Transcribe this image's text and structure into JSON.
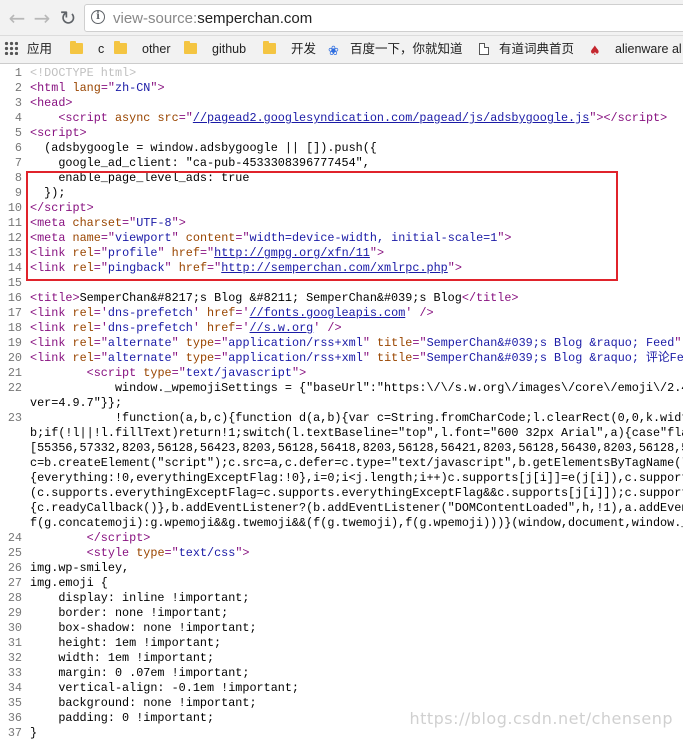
{
  "browser": {
    "back_icon": "arrow-left-icon",
    "forward_icon": "arrow-right-icon",
    "reload_icon": "reload-icon",
    "address": {
      "scheme": "view-source:",
      "host": "semperchan.com"
    }
  },
  "bookmarks": [
    {
      "label": "应用",
      "icon": "apps-grid-icon"
    },
    {
      "label": "c",
      "icon": "folder-icon"
    },
    {
      "label": "other",
      "icon": "folder-icon"
    },
    {
      "label": "github",
      "icon": "folder-icon"
    },
    {
      "label": "开发",
      "icon": "folder-icon"
    },
    {
      "label": "百度一下，你就知道",
      "icon": "paw-icon"
    },
    {
      "label": "有道词典首页",
      "icon": "page-icon"
    },
    {
      "label": "alienware al",
      "icon": "brand-icon"
    }
  ],
  "source_lines": [
    {
      "n": "1",
      "html": "<span class='doctype'>&lt;!DOCTYPE html&gt;</span>"
    },
    {
      "n": "2",
      "html": "<span class='tag'>&lt;html </span><span class='attr'>lang</span><span class='tag'>=\"</span><span class='val'>zh-CN</span><span class='tag'>\"&gt;</span>"
    },
    {
      "n": "3",
      "html": "<span class='tag'>&lt;head&gt;</span>"
    },
    {
      "n": "4",
      "html": "    <span class='tag'>&lt;script </span><span class='attr'>async src</span><span class='tag'>=\"</span><span class='link'>//pagead2.googlesyndication.com/pagead/js/adsbygoogle.js</span><span class='tag'>\"&gt;&lt;/script&gt;</span>"
    },
    {
      "n": "5",
      "html": "<span class='tag'>&lt;script&gt;</span>"
    },
    {
      "n": "6",
      "html": "  (adsbygoogle = window.adsbygoogle || []).push({"
    },
    {
      "n": "7",
      "html": "    google_ad_client: \"ca-pub-4533308396777454\","
    },
    {
      "n": "8",
      "html": "    enable_page_level_ads: true"
    },
    {
      "n": "9",
      "html": "  });"
    },
    {
      "n": "10",
      "html": "<span class='tag'>&lt;/script&gt;</span>"
    },
    {
      "n": "11",
      "html": "<span class='tag'>&lt;meta </span><span class='attr'>charset</span><span class='tag'>=\"</span><span class='val'>UTF-8</span><span class='tag'>\"&gt;</span>"
    },
    {
      "n": "12",
      "html": "<span class='tag'>&lt;meta </span><span class='attr'>name</span><span class='tag'>=\"</span><span class='val'>viewport</span><span class='tag'>\" </span><span class='attr'>content</span><span class='tag'>=\"</span><span class='val'>width=device-width, initial-scale=1</span><span class='tag'>\"&gt;</span>"
    },
    {
      "n": "13",
      "html": "<span class='tag'>&lt;link </span><span class='attr'>rel</span><span class='tag'>=\"</span><span class='val'>profile</span><span class='tag'>\" </span><span class='attr'>href</span><span class='tag'>=\"</span><span class='link'>http://gmpg.org/xfn/11</span><span class='tag'>\"&gt;</span>"
    },
    {
      "n": "14",
      "html": "<span class='tag'>&lt;link </span><span class='attr'>rel</span><span class='tag'>=\"</span><span class='val'>pingback</span><span class='tag'>\" </span><span class='attr'>href</span><span class='tag'>=\"</span><span class='link'>http://semperchan.com/xmlrpc.php</span><span class='tag'>\"&gt;</span>"
    },
    {
      "n": "15",
      "html": ""
    },
    {
      "n": "16",
      "html": "<span class='tag'>&lt;title&gt;</span>SemperChan&amp;#8217;s Blog &amp;#8211; SemperChan&amp;#039;s Blog<span class='tag'>&lt;/title&gt;</span>"
    },
    {
      "n": "17",
      "html": "<span class='tag'>&lt;link </span><span class='attr'>rel</span><span class='tag'>='</span><span class='val'>dns-prefetch</span><span class='tag'>' </span><span class='attr'>href</span><span class='tag'>='</span><span class='link'>//fonts.googleapis.com</span><span class='tag'>' /&gt;</span>"
    },
    {
      "n": "18",
      "html": "<span class='tag'>&lt;link </span><span class='attr'>rel</span><span class='tag'>='</span><span class='val'>dns-prefetch</span><span class='tag'>' </span><span class='attr'>href</span><span class='tag'>='</span><span class='link'>//s.w.org</span><span class='tag'>' /&gt;</span>"
    },
    {
      "n": "19",
      "html": "<span class='tag'>&lt;link </span><span class='attr'>rel</span><span class='tag'>=\"</span><span class='val'>alternate</span><span class='tag'>\" </span><span class='attr'>type</span><span class='tag'>=\"</span><span class='val'>application/rss+xml</span><span class='tag'>\" </span><span class='attr'>title</span><span class='tag'>=\"</span><span class='val'>SemperChan&amp;#039;s Blog &amp;raquo; Feed</span><span class='tag'>\" </span><span class='attr'>href</span><span class='tag'>=\"</span><span class='link'>ht</span>"
    },
    {
      "n": "20",
      "html": "<span class='tag'>&lt;link </span><span class='attr'>rel</span><span class='tag'>=\"</span><span class='val'>alternate</span><span class='tag'>\" </span><span class='attr'>type</span><span class='tag'>=\"</span><span class='val'>application/rss+xml</span><span class='tag'>\" </span><span class='attr'>title</span><span class='tag'>=\"</span><span class='val'>SemperChan&amp;#039;s Blog &amp;raquo; 评论Feed</span><span class='tag'>\" </span><span class='attr'>href</span>"
    },
    {
      "n": "21",
      "html": "        <span class='tag'>&lt;script </span><span class='attr'>type</span><span class='tag'>=\"</span><span class='val'>text/javascript</span><span class='tag'>\"&gt;</span>"
    },
    {
      "n": "22",
      "html": "            window._wpemojiSettings = {\"baseUrl\":\"https:\\/\\/s.w.org\\/images\\/core\\/emoji\\/2.4\\/72x72\\"
    },
    {
      "n": "",
      "html": "ver=4.9.7\"}};"
    },
    {
      "n": "23",
      "html": "            !function(a,b,c){function d(a,b){var c=String.fromCharCode;l.clearRect(0,0,k.width,k.heig"
    },
    {
      "n": "",
      "html": "b;if(!l||!l.fillText)return!1;switch(l.textBaseline=\"top\",l.font=\"600 32px Arial\",a){case\"flag\":retur"
    },
    {
      "n": "",
      "html": "[55356,57332,8203,56128,56423,8203,56128,56418,8203,56128,56421,8203,56128,56430,8203,56128,56423,820"
    },
    {
      "n": "",
      "html": "c=b.createElement(\"script\");c.src=a,c.defer=c.type=\"text/javascript\",b.getElementsByTagName(\"head\")[0"
    },
    {
      "n": "",
      "html": "{everything:!0,everythingExceptFlag:!0},i=0;i&lt;j.length;i++)c.supports[j[i]]=e(j[i]),c.supports.everyth"
    },
    {
      "n": "",
      "html": "(c.supports.everythingExceptFlag=c.supports.everythingExceptFlag&amp;&amp;c.supports[j[i]]);c.supports.everyt"
    },
    {
      "n": "",
      "html": "{c.readyCallback()},b.addEventListener?(b.addEventListener(\"DOMContentLoaded\",h,!1),a.addEventListene"
    },
    {
      "n": "",
      "html": "f(g.concatemoji):g.wpemoji&amp;&amp;g.twemoji&amp;&amp;(f(g.twemoji),f(g.wpemoji)))}(window,document,window._wpemojiS"
    },
    {
      "n": "24",
      "html": "        <span class='tag'>&lt;/script&gt;</span>"
    },
    {
      "n": "25",
      "html": "        <span class='tag'>&lt;style </span><span class='attr'>type</span><span class='tag'>=\"</span><span class='val'>text/css</span><span class='tag'>\"&gt;</span>"
    },
    {
      "n": "26",
      "html": "img.wp-smiley,"
    },
    {
      "n": "27",
      "html": "img.emoji {"
    },
    {
      "n": "28",
      "html": "    display: inline !important;"
    },
    {
      "n": "29",
      "html": "    border: none !important;"
    },
    {
      "n": "30",
      "html": "    box-shadow: none !important;"
    },
    {
      "n": "31",
      "html": "    height: 1em !important;"
    },
    {
      "n": "32",
      "html": "    width: 1em !important;"
    },
    {
      "n": "33",
      "html": "    margin: 0 .07em !important;"
    },
    {
      "n": "34",
      "html": "    vertical-align: -0.1em !important;"
    },
    {
      "n": "35",
      "html": "    background: none !important;"
    },
    {
      "n": "36",
      "html": "    padding: 0 !important;"
    },
    {
      "n": "37",
      "html": "}"
    }
  ],
  "watermark": "https://blog.csdn.net/chensenp"
}
